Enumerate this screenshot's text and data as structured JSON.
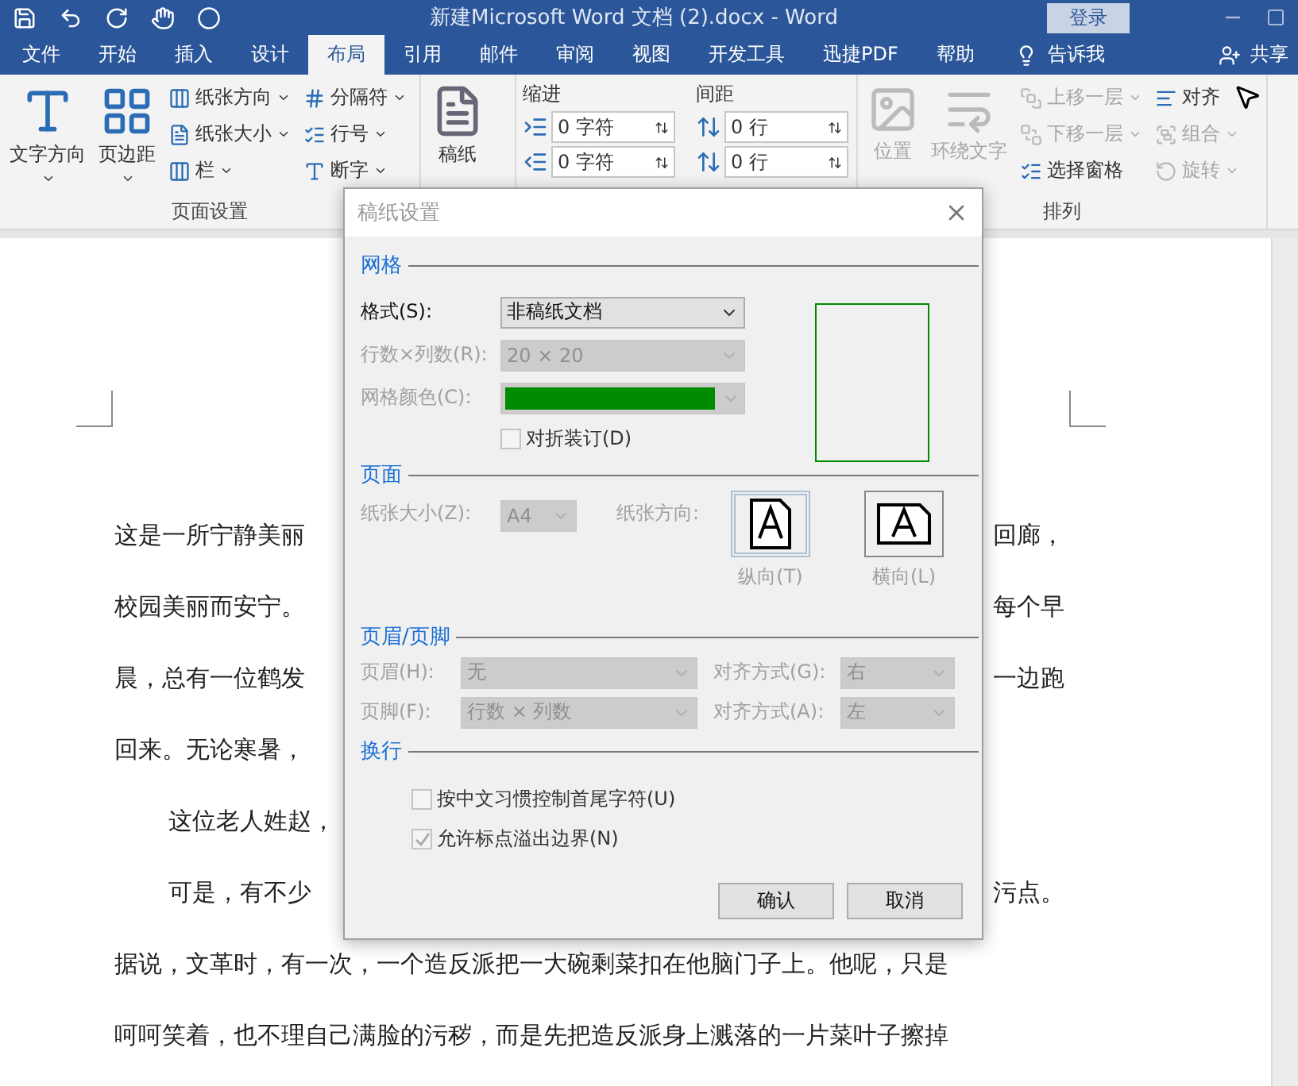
{
  "title_bar": {
    "title": "新建Microsoft Word 文档 (2).docx  -  Word",
    "sign_in": "登录"
  },
  "tabs": [
    {
      "label": "文件",
      "selected": false
    },
    {
      "label": "开始",
      "selected": false
    },
    {
      "label": "插入",
      "selected": false
    },
    {
      "label": "设计",
      "selected": false
    },
    {
      "label": "布局",
      "selected": true
    },
    {
      "label": "引用",
      "selected": false
    },
    {
      "label": "邮件",
      "selected": false
    },
    {
      "label": "审阅",
      "selected": false
    },
    {
      "label": "视图",
      "selected": false
    },
    {
      "label": "开发工具",
      "selected": false
    },
    {
      "label": "迅捷PDF",
      "selected": false
    },
    {
      "label": "帮助",
      "selected": false
    }
  ],
  "tell_me": "告诉我",
  "share": "共享",
  "page_setup": {
    "label": "页面设置",
    "large": [
      {
        "label": "文字方向"
      },
      {
        "label": "页边距"
      }
    ],
    "small": [
      {
        "label": "纸张方向",
        "dropdown": true
      },
      {
        "label": "纸张大小",
        "dropdown": true
      },
      {
        "label": "栏",
        "dropdown": true
      },
      {
        "label": "分隔符",
        "dropdown": true
      },
      {
        "label": "行号",
        "dropdown": true
      },
      {
        "label": "断字",
        "dropdown": true
      }
    ]
  },
  "manuscript": {
    "lines": [
      "稿纸"
    ]
  },
  "paragraph": {
    "columns": [
      {
        "label": "缩进",
        "fields": [
          "0 字符",
          "0 字符"
        ]
      },
      {
        "label": "间距",
        "fields": [
          "0 行",
          "0 行"
        ]
      }
    ]
  },
  "arrange": {
    "label": "排列",
    "large": [
      {
        "label": "位置",
        "disabled": true
      },
      {
        "label": "环绕文字",
        "disabled": true
      }
    ],
    "small": [
      {
        "label": "上移一层",
        "disabled": true,
        "dropdown": true
      },
      {
        "label": "下移一层",
        "disabled": true,
        "dropdown": true
      },
      {
        "label": "选择窗格",
        "disabled": false,
        "dropdown": false
      },
      {
        "label": "对齐",
        "disabled": false,
        "dropdown": false
      },
      {
        "label": "组合",
        "disabled": true,
        "dropdown": true
      },
      {
        "label": "旋转",
        "disabled": true,
        "dropdown": true
      }
    ]
  },
  "document": [
    {
      "indent": false,
      "left": "这是一所宁静美丽",
      "right": "回廊，"
    },
    {
      "indent": false,
      "left": "校园美丽而安宁。",
      "right": "每个早"
    },
    {
      "indent": false,
      "left": "晨，总有一位鹤发",
      "right": "一边跑"
    },
    {
      "indent": false,
      "left": "回来。无论寒暑，"
    },
    {
      "indent": true,
      "left": "这位老人姓赵，"
    },
    {
      "indent": true,
      "left": "可是，有不少",
      "right": "污点。"
    },
    {
      "indent": false,
      "left": "据说，文革时，有一次，一个造反派把一大碗剩菜扣在他脑门子上。他呢，只是"
    },
    {
      "indent": false,
      "left": "呵呵笑着，也不理自己满脸的污秽，而是先把造反派身上溅落的一片菜叶子擦掉"
    }
  ],
  "dialog": {
    "title": "稿纸设置",
    "grid": {
      "heading": "网格",
      "format": {
        "label": "格式(S):",
        "value": "非稿纸文档",
        "disabled": false
      },
      "size": {
        "label": "行数×列数(R):",
        "value": "20 × 20",
        "disabled": true
      },
      "color": {
        "label": "网格颜色(C):",
        "color": "#008c00",
        "disabled": true
      },
      "fold": {
        "label": "对折装订(D)",
        "checked": false,
        "disabled": true
      }
    },
    "page": {
      "heading": "页面",
      "paper_size": {
        "label": "纸张大小(Z):",
        "value": "A4",
        "disabled": true
      },
      "orientation_label": "纸张方向:",
      "orientations": [
        {
          "label": "纵向(T)",
          "selected": true,
          "disabled": true
        },
        {
          "label": "横向(L)",
          "selected": false,
          "disabled": true
        }
      ]
    },
    "header_footer": {
      "heading": "页眉/页脚",
      "rows": [
        {
          "label": "页眉(H):",
          "value": "无",
          "align_label": "对齐方式(G):",
          "align": "右",
          "disabled": true
        },
        {
          "label": "页脚(F):",
          "value": "行数 × 列数",
          "align_label": "对齐方式(A):",
          "align": "左",
          "disabled": true
        }
      ]
    },
    "line_break": {
      "heading": "换行",
      "options": [
        {
          "label": "按中文习惯控制首尾字符(U)",
          "checked": false,
          "disabled": true
        },
        {
          "label": "允许标点溢出边界(N)",
          "checked": true,
          "disabled": true
        }
      ]
    },
    "buttons": [
      "确认",
      "取消"
    ]
  }
}
